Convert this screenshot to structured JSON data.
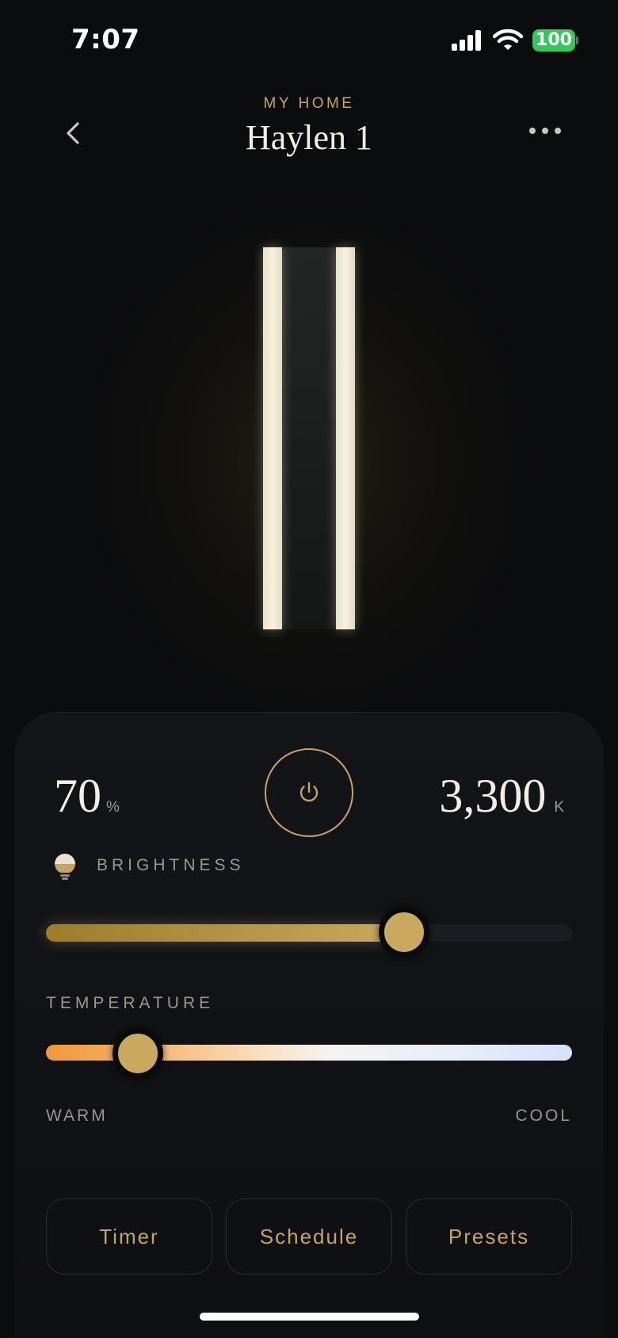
{
  "status_bar": {
    "time": "7:07",
    "battery_level": "100",
    "icons": [
      "signal-icon",
      "wifi-icon",
      "battery-icon"
    ],
    "battery_color": "#34c759"
  },
  "header": {
    "location": "MY HOME",
    "title": "Haylen 1",
    "icons": [
      "back-chevron-icon",
      "more-dots-icon"
    ]
  },
  "controls": {
    "brightness": {
      "value": "70",
      "unit": "%",
      "fraction": 0.7,
      "label": "BRIGHTNESS"
    },
    "temperature": {
      "value": "3,300",
      "unit": "K",
      "fraction": 0.14,
      "label": "TEMPERATURE",
      "min_label": "WARM",
      "max_label": "COOL"
    },
    "power_icon": "power-icon",
    "bulb_icon": "bulb-icon"
  },
  "actions": [
    {
      "label": "Timer"
    },
    {
      "label": "Schedule"
    },
    {
      "label": "Presets"
    }
  ],
  "colors": {
    "accent": "#c8a45e",
    "background": "#0b0c0e",
    "panel": "#131518"
  }
}
